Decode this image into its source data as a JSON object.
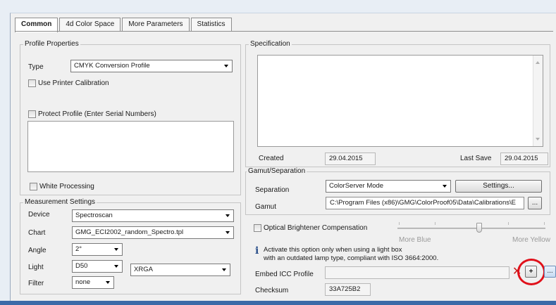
{
  "tabs": [
    {
      "label": "Common"
    },
    {
      "label": "4d Color Space"
    },
    {
      "label": "More Parameters"
    },
    {
      "label": "Statistics"
    }
  ],
  "profile_properties": {
    "legend": "Profile Properties",
    "type_label": "Type",
    "type_value": "CMYK Conversion Profile",
    "use_printer_calibration": "Use Printer Calibration",
    "protect_profile": "Protect Profile (Enter Serial Numbers)",
    "white_processing": "White Processing"
  },
  "measurement_settings": {
    "legend": "Measurement Settings",
    "device_label": "Device",
    "device_value": "Spectroscan",
    "chart_label": "Chart",
    "chart_value": "GMG_ECI2002_random_Spectro.tpl",
    "angle_label": "Angle",
    "angle_value": "2°",
    "light_label": "Light",
    "light_value": "D50",
    "light_mode_value": "XRGA",
    "filter_label": "Filter",
    "filter_value": "none"
  },
  "specification": {
    "legend": "Specification",
    "created_label": "Created",
    "created_value": "29.04.2015",
    "last_save_label": "Last Save",
    "last_save_value": "29.04.2015"
  },
  "gamut_separation": {
    "legend": "Gamut/Separation",
    "separation_label": "Separation",
    "separation_value": "ColorServer Mode",
    "settings_button": "Settings...",
    "gamut_label": "Gamut",
    "gamut_value": "C:\\Program Files (x86)\\GMG\\ColorProof05\\Data\\Calibrations\\E",
    "browse_button": "..."
  },
  "optical": {
    "label": "Optical Brightener Compensation",
    "slider_left": "More Blue",
    "slider_right": "More Yellow",
    "slider_value": 0.55,
    "info_text_1": "Activate this option only when using a light box",
    "info_text_2": "with an outdated lamp type, compliant with ISO 3664:2000."
  },
  "embed": {
    "label": "Embed ICC Profile",
    "checksum_label": "Checksum",
    "checksum_value": "33A725B2",
    "extra_button": "..."
  },
  "colors": {
    "highlight_circle": "#e0101a",
    "delete_icon": "#c81818",
    "bottom_bar": "#3b6aa8"
  }
}
